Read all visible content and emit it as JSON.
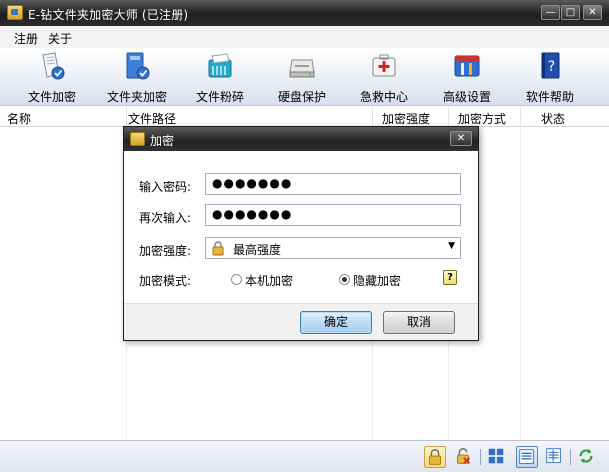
{
  "window": {
    "title": "E-钻文件夹加密大师 (已注册)",
    "min": "—",
    "max": "□",
    "close": "✕"
  },
  "menu": [
    "注册",
    "关于"
  ],
  "toolbar": [
    {
      "label": "文件加密",
      "icon": "file-encrypt-icon"
    },
    {
      "label": "文件夹加密",
      "icon": "folder-encrypt-icon"
    },
    {
      "label": "文件粉碎",
      "icon": "file-shred-icon"
    },
    {
      "label": "硬盘保护",
      "icon": "disk-protect-icon"
    },
    {
      "label": "急救中心",
      "icon": "first-aid-icon"
    },
    {
      "label": "高级设置",
      "icon": "advanced-settings-icon"
    },
    {
      "label": "软件帮助",
      "icon": "help-book-icon"
    }
  ],
  "columns": [
    "名称",
    "文件路径",
    "加密强度",
    "加密方式",
    "状态"
  ],
  "dialog": {
    "title": "加密",
    "close": "✕",
    "password_label": "输入密码:",
    "password_value": "●●●●●●●",
    "confirm_label": "再次输入:",
    "confirm_value": "●●●●●●●",
    "strength_label": "加密强度:",
    "strength_value": "最高强度",
    "mode_label": "加密模式:",
    "mode_local": "本机加密",
    "mode_hidden": "隐藏加密",
    "selected_mode": "隐藏加密",
    "help": "?",
    "ok": "确定",
    "cancel": "取消"
  },
  "colors": {
    "titlebar": "#2a2a2a",
    "toolbar": "#e9edf6",
    "default_button": "#bcdaf3"
  }
}
